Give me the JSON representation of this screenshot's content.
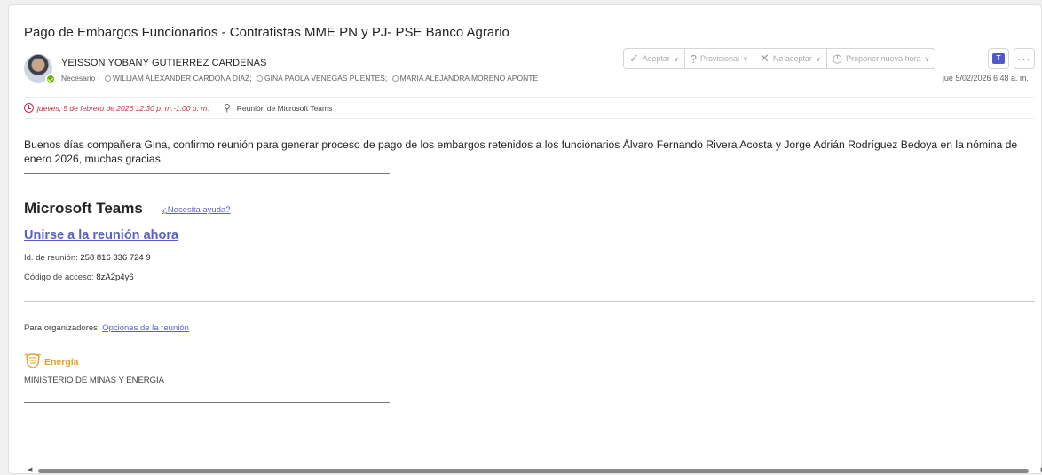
{
  "message": {
    "subject": "Pago de Embargos Funcionarios - Contratistas MME PN y PJ- PSE Banco Agrario",
    "sender": "YEISSON YOBANY GUTIERREZ CARDENAS",
    "required_label": "Necesario ·",
    "recipients": [
      "WILLIAM ALEXANDER CARDONA DIAZ;",
      "GINA PAOLA VENEGAS PUENTES;",
      "MARIA ALEJANDRA MORENO APONTE"
    ],
    "received": "jue 5/02/2026 6:48 a. m.",
    "meeting_time": "jueves, 5 de febrero de 2026 12:30 p. m.-1:00 p. m.",
    "meeting_location": "Reunión de Microsoft Teams"
  },
  "toolbar": {
    "accept": "Aceptar",
    "tentative": "Provisional",
    "decline": "No aceptar",
    "propose": "Proponer nueva hora",
    "more": "···"
  },
  "body": {
    "greeting": "Buenos días compañera Gina, confirmo reunión para generar proceso de pago de los embargos retenidos a los funcionarios Álvaro Fernando Rivera Acosta y Jorge Adrián Rodríguez Bedoya en la nómina de enero 2026, muchas gracias.",
    "teams_title": "Microsoft Teams",
    "help_link": "¿Necesita ayuda?",
    "join_link": "Unirse a la reunión ahora",
    "meeting_id_label": "Id. de reunión:",
    "meeting_id": "258 816 336 724 9",
    "passcode_label": "Código de acceso:",
    "passcode": "8zA2p4y6",
    "organizers_label": "Para organizadores:",
    "options_link": "Opciones de la reunión",
    "logo_word": "Energía",
    "ministry": "MINISTERIO DE MINAS Y ENERGIA"
  },
  "colors": {
    "accent": "#5b5fc7",
    "meeting_red": "#c4314b",
    "presence_green": "#6bb700",
    "logo_gold": "#e0a22a"
  }
}
